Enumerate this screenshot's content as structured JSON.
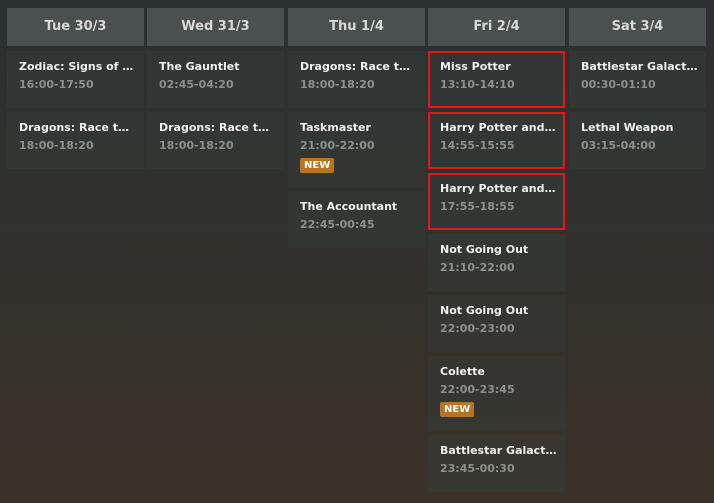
{
  "days": [
    {
      "label": "Tue 30/3",
      "shows": [
        {
          "title": "Zodiac: Signs of the Apocalypse",
          "time": "16:00-17:50"
        },
        {
          "title": "Dragons: Race to the Edge",
          "time": "18:00-18:20"
        }
      ]
    },
    {
      "label": "Wed 31/3",
      "shows": [
        {
          "title": "The Gauntlet",
          "time": "02:45-04:20"
        },
        {
          "title": "Dragons: Race to the Edge",
          "time": "18:00-18:20"
        }
      ]
    },
    {
      "label": "Thu 1/4",
      "shows": [
        {
          "title": "Dragons: Race to the Edge",
          "time": "18:00-18:20"
        },
        {
          "title": "Taskmaster",
          "time": "21:00-22:00",
          "badge": "NEW"
        },
        {
          "title": "The Accountant",
          "time": "22:45-00:45"
        }
      ]
    },
    {
      "label": "Fri 2/4",
      "shows": [
        {
          "title": "Miss Potter",
          "time": "13:10-14:10",
          "selected": true
        },
        {
          "title": "Harry Potter and the Chamber of Secrets",
          "time": "14:55-15:55",
          "selected": true
        },
        {
          "title": "Harry Potter and the Prisoner of Azkaban",
          "time": "17:55-18:55",
          "selected": true
        },
        {
          "title": "Not Going Out",
          "time": "21:10-22:00"
        },
        {
          "title": "Not Going Out",
          "time": "22:00-23:00"
        },
        {
          "title": "Colette",
          "time": "22:00-23:45",
          "badge": "NEW"
        },
        {
          "title": "Battlestar Galactica",
          "time": "23:45-00:30"
        }
      ]
    },
    {
      "label": "Sat 3/4",
      "shows": [
        {
          "title": "Battlestar Galactica",
          "time": "00:30-01:10"
        },
        {
          "title": "Lethal Weapon",
          "time": "03:15-04:00"
        }
      ]
    }
  ]
}
